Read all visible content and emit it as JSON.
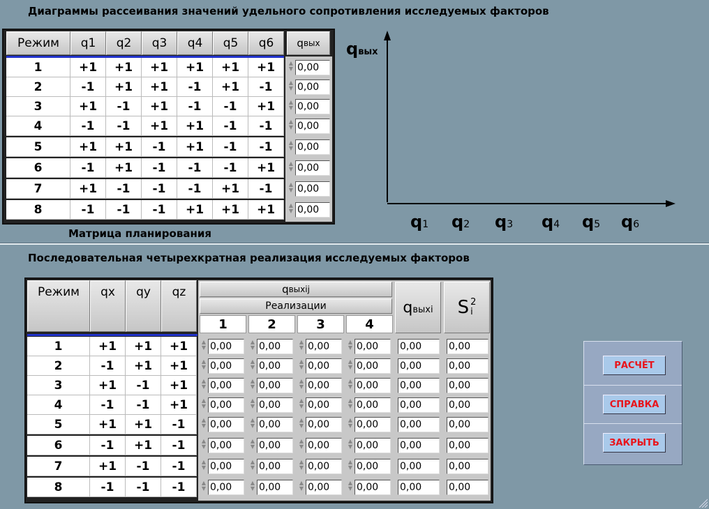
{
  "top_title": "Диаграммы рассеивания значений удельного сопротивления исследуемых факторов",
  "matrix_caption": "Матрица планирования",
  "bottom_title": "Последовательная четырехкратная реализация исследуемых факторов",
  "plan_table": {
    "headers": [
      "Режим",
      "q1",
      "q2",
      "q3",
      "q4",
      "q5",
      "q6"
    ],
    "out_header": "q",
    "out_header_sub": "вых",
    "rows": [
      {
        "mode": "1",
        "q": [
          "+1",
          "+1",
          "+1",
          "+1",
          "+1",
          "+1"
        ],
        "out": "0,00"
      },
      {
        "mode": "2",
        "q": [
          "-1",
          "+1",
          "+1",
          "-1",
          "+1",
          "-1"
        ],
        "out": "0,00"
      },
      {
        "mode": "3",
        "q": [
          "+1",
          "-1",
          "+1",
          "-1",
          "-1",
          "+1"
        ],
        "out": "0,00"
      },
      {
        "mode": "4",
        "q": [
          "-1",
          "-1",
          "+1",
          "+1",
          "-1",
          "-1"
        ],
        "out": "0,00"
      },
      {
        "mode": "5",
        "q": [
          "+1",
          "+1",
          "-1",
          "+1",
          "-1",
          "-1"
        ],
        "out": "0,00"
      },
      {
        "mode": "6",
        "q": [
          "-1",
          "+1",
          "-1",
          "-1",
          "-1",
          "+1"
        ],
        "out": "0,00"
      },
      {
        "mode": "7",
        "q": [
          "+1",
          "-1",
          "-1",
          "-1",
          "+1",
          "-1"
        ],
        "out": "0,00"
      },
      {
        "mode": "8",
        "q": [
          "-1",
          "-1",
          "-1",
          "+1",
          "+1",
          "+1"
        ],
        "out": "0,00"
      }
    ]
  },
  "chart": {
    "y_label": "q",
    "y_label_sub": "вых",
    "x_labels": [
      {
        "main": "q",
        "sub": "1"
      },
      {
        "main": "q",
        "sub": "2"
      },
      {
        "main": "q",
        "sub": "3"
      },
      {
        "main": "q",
        "sub": "4"
      },
      {
        "main": "q",
        "sub": "5"
      },
      {
        "main": "q",
        "sub": "6"
      }
    ]
  },
  "real_table": {
    "headers": [
      "Режим",
      "qx",
      "qy",
      "qz"
    ],
    "group_header": "q",
    "group_header_sub": "выхij",
    "subgroup_header": "Реализации",
    "realization_numbers": [
      "1",
      "2",
      "3",
      "4"
    ],
    "avg_header": "q",
    "avg_header_sub": "выхi",
    "s_header": "S",
    "s_header_sup": "2",
    "s_header_sub": "i",
    "rows": [
      {
        "mode": "1",
        "f": [
          "+1",
          "+1",
          "+1"
        ],
        "r": [
          "0,00",
          "0,00",
          "0,00",
          "0,00"
        ],
        "avg": "0,00",
        "s": "0,00"
      },
      {
        "mode": "2",
        "f": [
          "-1",
          "+1",
          "+1"
        ],
        "r": [
          "0,00",
          "0,00",
          "0,00",
          "0,00"
        ],
        "avg": "0,00",
        "s": "0,00"
      },
      {
        "mode": "3",
        "f": [
          "+1",
          "-1",
          "+1"
        ],
        "r": [
          "0,00",
          "0,00",
          "0,00",
          "0,00"
        ],
        "avg": "0,00",
        "s": "0,00"
      },
      {
        "mode": "4",
        "f": [
          "-1",
          "-1",
          "+1"
        ],
        "r": [
          "0,00",
          "0,00",
          "0,00",
          "0,00"
        ],
        "avg": "0,00",
        "s": "0,00"
      },
      {
        "mode": "5",
        "f": [
          "+1",
          "+1",
          "-1"
        ],
        "r": [
          "0,00",
          "0,00",
          "0,00",
          "0,00"
        ],
        "avg": "0,00",
        "s": "0,00"
      },
      {
        "mode": "6",
        "f": [
          "-1",
          "+1",
          "-1"
        ],
        "r": [
          "0,00",
          "0,00",
          "0,00",
          "0,00"
        ],
        "avg": "0,00",
        "s": "0,00"
      },
      {
        "mode": "7",
        "f": [
          "+1",
          "-1",
          "-1"
        ],
        "r": [
          "0,00",
          "0,00",
          "0,00",
          "0,00"
        ],
        "avg": "0,00",
        "s": "0,00"
      },
      {
        "mode": "8",
        "f": [
          "-1",
          "-1",
          "-1"
        ],
        "r": [
          "0,00",
          "0,00",
          "0,00",
          "0,00"
        ],
        "avg": "0,00",
        "s": "0,00"
      }
    ]
  },
  "buttons": {
    "calc": "РАСЧЁТ",
    "help": "СПРАВКА",
    "close": "ЗАКРЫТЬ"
  },
  "colors": {
    "background": "#7f98a6",
    "button_text": "#e8141b",
    "button_face": "#a9c9ea",
    "panel": "#97a8c2",
    "header_line": "#2233cc"
  }
}
